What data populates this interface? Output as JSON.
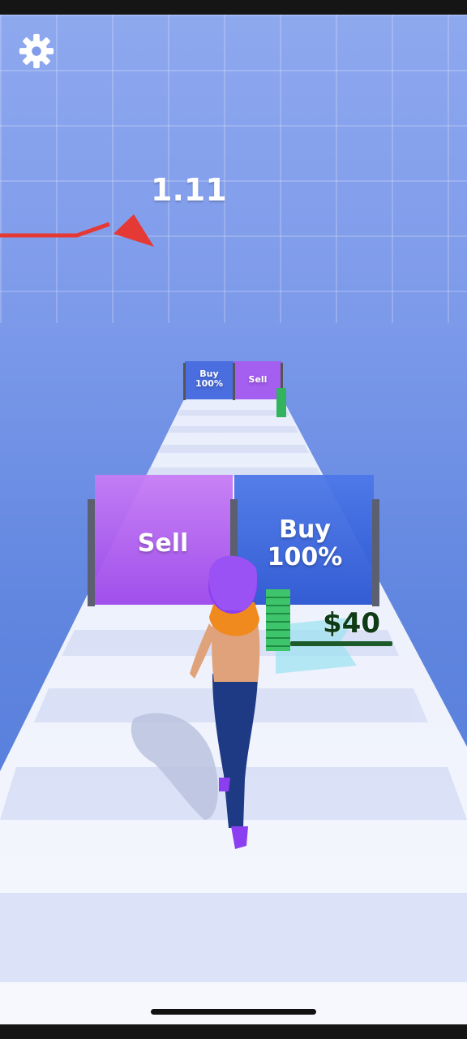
{
  "hud": {
    "settings_icon": "gear-icon",
    "multiplier_value": "1.11",
    "trend_direction": "up",
    "trend_color": "#e53935"
  },
  "gates": {
    "near_left": {
      "label": "Sell",
      "color": "#b35bf0"
    },
    "near_right": {
      "label": "Buy\n100%",
      "color": "#2f5ed8"
    },
    "far_left": {
      "label": "Buy\n100%",
      "color": "#4a6ee0"
    },
    "far_right": {
      "label": "Sell",
      "color": "#a45ef0"
    }
  },
  "player": {
    "money_label": "$40",
    "hair_color": "#8b3ff0",
    "cash_color": "#3ec46a"
  }
}
